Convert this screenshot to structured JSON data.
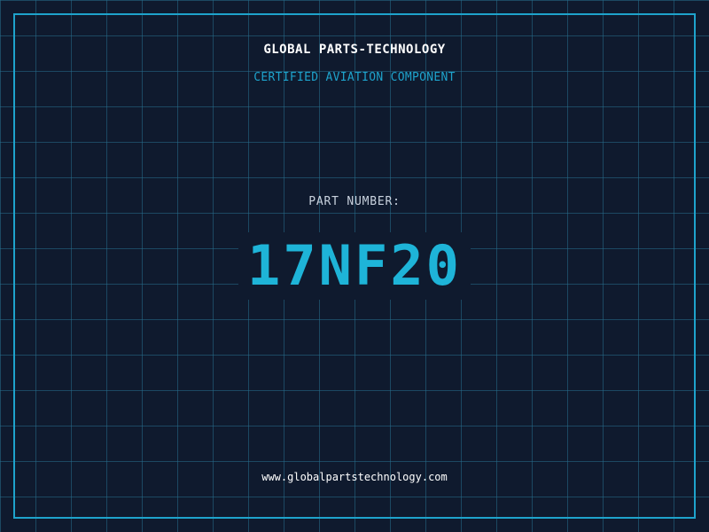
{
  "header": {
    "company": "GLOBAL PARTS-TECHNOLOGY",
    "subtitle": "CERTIFIED AVIATION COMPONENT"
  },
  "main": {
    "label": "PART NUMBER:",
    "part_number": "17NF20"
  },
  "footer": {
    "url": "www.globalpartstechnology.com"
  },
  "colors": {
    "background": "#0f1a2e",
    "grid": "#266e8c",
    "accent": "#1ea3cc",
    "part_number": "#1eb4d8",
    "text": "#ffffff"
  }
}
